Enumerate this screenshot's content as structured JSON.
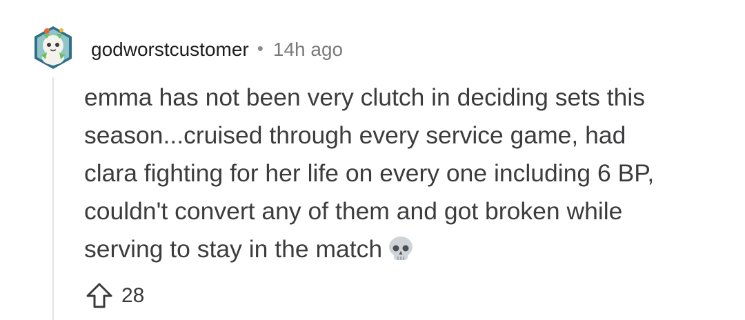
{
  "comment": {
    "username": "godworstcustomer",
    "separator": "•",
    "timestamp": "14h ago",
    "body_lines": [
      "emma has not been very clutch in deciding sets this",
      "season...cruised through every service game, had",
      "clara fighting for her life on every one including 6 BP,",
      "couldn't convert any of them and got broken while",
      "serving to stay in the match"
    ],
    "emoji": "skull-emoji",
    "upvote_icon": "upvote-arrow-icon",
    "score": "28"
  },
  "colors": {
    "username": "#1c1c1e",
    "timestamp": "#7a7a7a",
    "body": "#3c3c3e",
    "thread_line": "#e2e2e2"
  }
}
